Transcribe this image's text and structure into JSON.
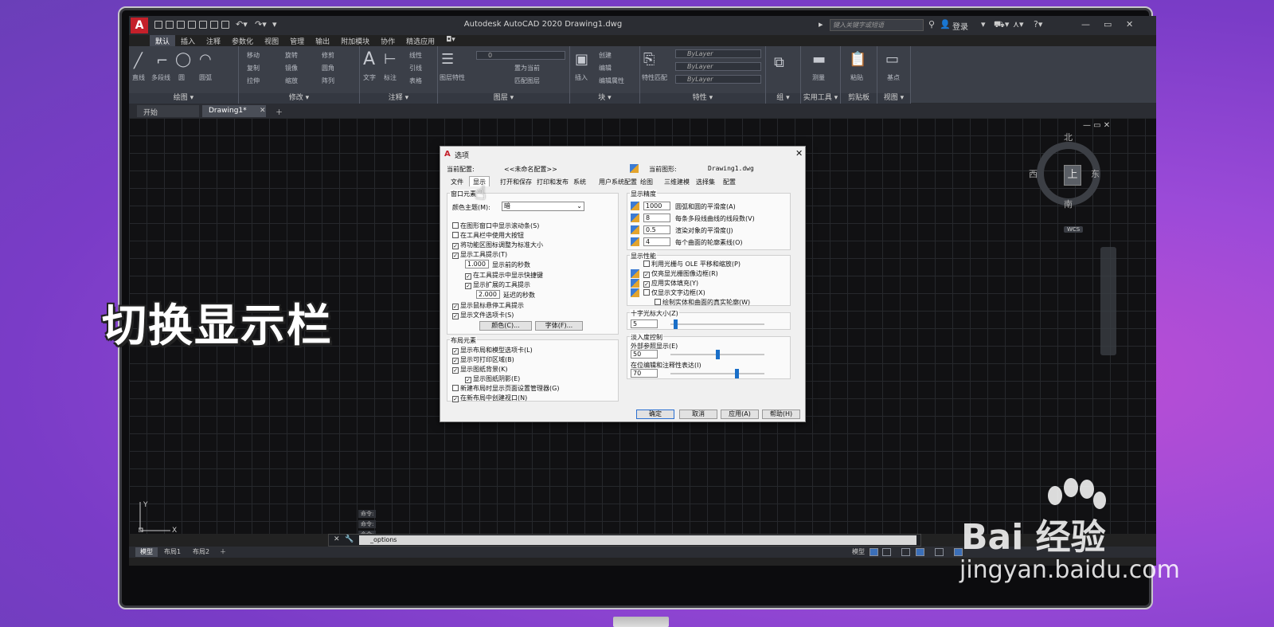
{
  "overlay_title": "切换显示栏",
  "watermark": {
    "brand": "Bai 经验",
    "url": "jingyan.baidu.com"
  },
  "acad": {
    "app_logo": "A",
    "title": "Autodesk AutoCAD 2020    Drawing1.dwg",
    "search_placeholder": "键入关键字或短语",
    "login": "登录",
    "ribbon_tabs": [
      "默认",
      "插入",
      "注释",
      "参数化",
      "视图",
      "管理",
      "输出",
      "附加模块",
      "协作",
      "精选应用"
    ],
    "panels": {
      "draw": {
        "label": "绘图 ▾",
        "tools": [
          "直线",
          "多段线",
          "圆",
          "圆弧"
        ]
      },
      "modify": {
        "label": "修改 ▾",
        "tools": [
          "移动",
          "旋转",
          "修剪",
          "复制",
          "镜像",
          "圆角",
          "拉伸",
          "缩放",
          "阵列"
        ]
      },
      "annotation": {
        "label": "注释 ▾",
        "tools": [
          "文字",
          "标注",
          "线性",
          "引线",
          "表格"
        ]
      },
      "layers": {
        "label": "图层 ▾",
        "layer_value": "0",
        "tools": [
          "图层特性",
          "置为当前",
          "匹配图层"
        ]
      },
      "block": {
        "label": "块 ▾",
        "tools": [
          "插入",
          "创建",
          "编辑",
          "编辑属性"
        ]
      },
      "properties": {
        "label": "特性 ▾",
        "bylayer": [
          "ByLayer",
          "ByLayer",
          "ByLayer"
        ],
        "tools": [
          "特性匹配"
        ]
      },
      "groups": {
        "label": "组 ▾"
      },
      "utilities": {
        "label": "实用工具 ▾",
        "tools": [
          "测量"
        ]
      },
      "clipboard": {
        "label": "剪贴板",
        "tools": [
          "粘贴"
        ]
      },
      "view": {
        "label": "视图 ▾",
        "tools": [
          "基点"
        ]
      }
    },
    "doc_tabs": [
      "开始",
      "Drawing1*"
    ],
    "viewcube": {
      "face": "上",
      "north": "北",
      "south": "南",
      "east": "东",
      "west": "西",
      "wcs": "WCS"
    },
    "cmd_history": [
      "命令:",
      "命令:",
      "命令:"
    ],
    "cmd_input": "_options",
    "layout_tabs": [
      "模型",
      "布局1",
      "布局2"
    ],
    "status_model": "模型"
  },
  "dialog": {
    "title": "选项",
    "current_profile_label": "当前配置:",
    "current_profile_value": "<<未命名配置>>",
    "current_drawing_label": "当前图形:",
    "current_drawing_value": "Drawing1.dwg",
    "tabs": [
      "文件",
      "显示",
      "打开和保存",
      "打印和发布",
      "系统",
      "用户系统配置",
      "绘图",
      "三维建模",
      "选择集",
      "配置"
    ],
    "window_elements": {
      "title": "窗口元素",
      "color_scheme_label": "颜色主题(M):",
      "color_scheme_value": "暗",
      "options": [
        {
          "label": "在图形窗口中显示滚动条(S)",
          "checked": false
        },
        {
          "label": "在工具栏中使用大按钮",
          "checked": false
        },
        {
          "label": "将功能区图标调整为标准大小",
          "checked": true
        },
        {
          "label": "显示工具提示(T)",
          "checked": true
        }
      ],
      "tooltip_delay_value": "1.000",
      "tooltip_delay_label": "显示前的秒数",
      "sub_options": [
        {
          "label": "在工具提示中显示快捷键",
          "checked": true
        },
        {
          "label": "显示扩展的工具提示",
          "checked": true
        }
      ],
      "ext_delay_value": "2.000",
      "ext_delay_label": "延迟的秒数",
      "options2": [
        {
          "label": "显示鼠标悬停工具提示",
          "checked": true
        },
        {
          "label": "显示文件选项卡(S)",
          "checked": true
        }
      ],
      "colors_button": "颜色(C)...",
      "fonts_button": "字体(F)..."
    },
    "layout_elements": {
      "title": "布局元素",
      "options": [
        {
          "label": "显示布局和模型选项卡(L)",
          "checked": true
        },
        {
          "label": "显示可打印区域(B)",
          "checked": true
        },
        {
          "label": "显示图纸背景(K)",
          "checked": true
        },
        {
          "label": "显示图纸阴影(E)",
          "checked": true
        },
        {
          "label": "新建布局时显示页面设置管理器(G)",
          "checked": false
        },
        {
          "label": "在新布局中创建视口(N)",
          "checked": true
        }
      ]
    },
    "display_resolution": {
      "title": "显示精度",
      "rows": [
        {
          "value": "1000",
          "label": "圆弧和圆的平滑度(A)"
        },
        {
          "value": "8",
          "label": "每条多段线曲线的线段数(V)"
        },
        {
          "value": "0.5",
          "label": "渲染对象的平滑度(J)"
        },
        {
          "value": "4",
          "label": "每个曲面的轮廓素线(O)"
        }
      ]
    },
    "display_performance": {
      "title": "显示性能",
      "options": [
        {
          "label": "利用光栅与 OLE 平移和缩放(P)",
          "checked": false
        },
        {
          "label": "仅亮显光栅图像边框(R)",
          "checked": true
        },
        {
          "label": "应用实体填充(Y)",
          "checked": true
        },
        {
          "label": "仅显示文字边框(X)",
          "checked": false
        },
        {
          "label": "绘制实体和曲面的真实轮廓(W)",
          "checked": false
        }
      ]
    },
    "crosshair": {
      "title": "十字光标大小(Z)",
      "value": "5",
      "level_percent": 5
    },
    "fade": {
      "title": "淡入度控制",
      "xref_label": "外部参照显示(E)",
      "xref_value": "50",
      "xref_percent": 50,
      "inplace_label": "在位编辑和注释性表达(I)",
      "inplace_value": "70",
      "inplace_percent": 70
    },
    "buttons": {
      "ok": "确定",
      "cancel": "取消",
      "apply": "应用(A)",
      "help": "帮助(H)"
    },
    "close": "✕"
  }
}
